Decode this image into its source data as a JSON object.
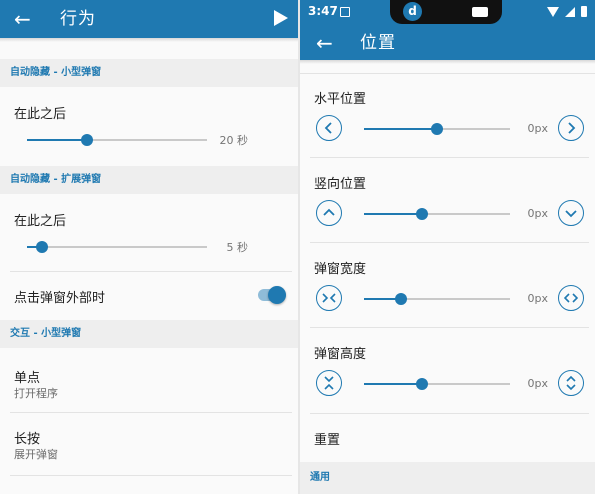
{
  "left": {
    "app_title": "行为",
    "sections": [
      {
        "header": "自动隐藏 - 小型弹窗"
      },
      {
        "header": "自动隐藏 - 扩展弹窗"
      },
      {
        "header": "交互 - 小型弹窗"
      }
    ],
    "after_small": {
      "title": "在此之后",
      "value": 20,
      "max": 60,
      "value_label": "20 秒"
    },
    "after_expanded": {
      "title": "在此之后",
      "value": 5,
      "max": 60,
      "value_label": "5 秒"
    },
    "tap_outside": {
      "title": "点击弹窗外部时",
      "enabled": true
    },
    "single_tap": {
      "title": "单点",
      "subtitle": "打开程序"
    },
    "long_press": {
      "title": "长按",
      "subtitle": "展开弹窗"
    }
  },
  "right": {
    "status_time": "3:47",
    "notch_app": "d",
    "app_title": "位置",
    "horizontal": {
      "title": "水平位置",
      "value_label": "0px",
      "fraction": 0.5
    },
    "vertical": {
      "title": "竖向位置",
      "value_label": "0px",
      "fraction": 0.4
    },
    "width": {
      "title": "弹窗宽度",
      "value_label": "0px",
      "fraction": 0.25
    },
    "height": {
      "title": "弹窗高度",
      "value_label": "0px",
      "fraction": 0.4
    },
    "reset": "重置",
    "general_header": "通用"
  },
  "colors": {
    "accent": "#1f79b1",
    "section_bg": "#eeeeee",
    "bg": "#fafafa"
  }
}
